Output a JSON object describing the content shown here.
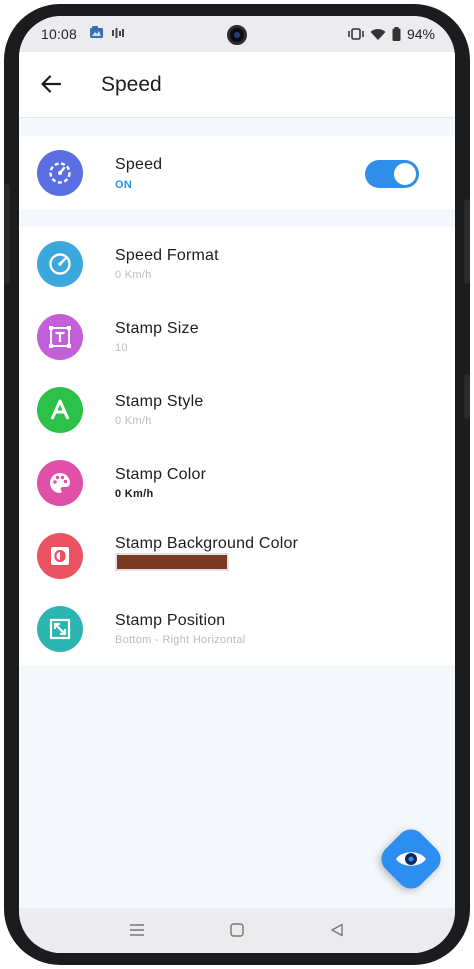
{
  "status_bar": {
    "time": "10:08",
    "battery": "94%",
    "icons": [
      "gallery-icon",
      "signal-bars-icon",
      "vibrate-icon",
      "wifi-icon",
      "battery-icon"
    ]
  },
  "app_bar": {
    "title": "Speed",
    "back_icon": "arrow-left-icon"
  },
  "speed_toggle": {
    "title": "Speed",
    "status": "ON",
    "enabled": true,
    "icon": "speedometer-icon",
    "icon_color": "#5b6ee1"
  },
  "settings": [
    {
      "title": "Speed Format",
      "value": "0 Km/h",
      "icon": "gauge-icon",
      "icon_color": "#3aa8df"
    },
    {
      "title": "Stamp Size",
      "value": "10",
      "icon": "text-size-icon",
      "icon_color": "#c35fd8"
    },
    {
      "title": "Stamp Style",
      "value": "0 Km/h",
      "icon": "letter-a-icon",
      "icon_color": "#2cc24a"
    },
    {
      "title": "Stamp Color",
      "value": "0 Km/h",
      "icon": "palette-icon",
      "icon_color": "#e04fa8"
    },
    {
      "title": "Stamp Background Color",
      "swatch_color": "#7a3a22",
      "icon": "background-fill-icon",
      "icon_color": "#ec5360"
    },
    {
      "title": "Stamp Position",
      "value": "Bottom - Right Horizontal",
      "icon": "move-corners-icon",
      "icon_color": "#2cb5b0"
    }
  ],
  "fab": {
    "icon": "eye-icon",
    "color": "#2b8ef0"
  },
  "nav_bar": {
    "icons": [
      "recents-icon",
      "home-icon",
      "back-triangle-icon"
    ]
  }
}
